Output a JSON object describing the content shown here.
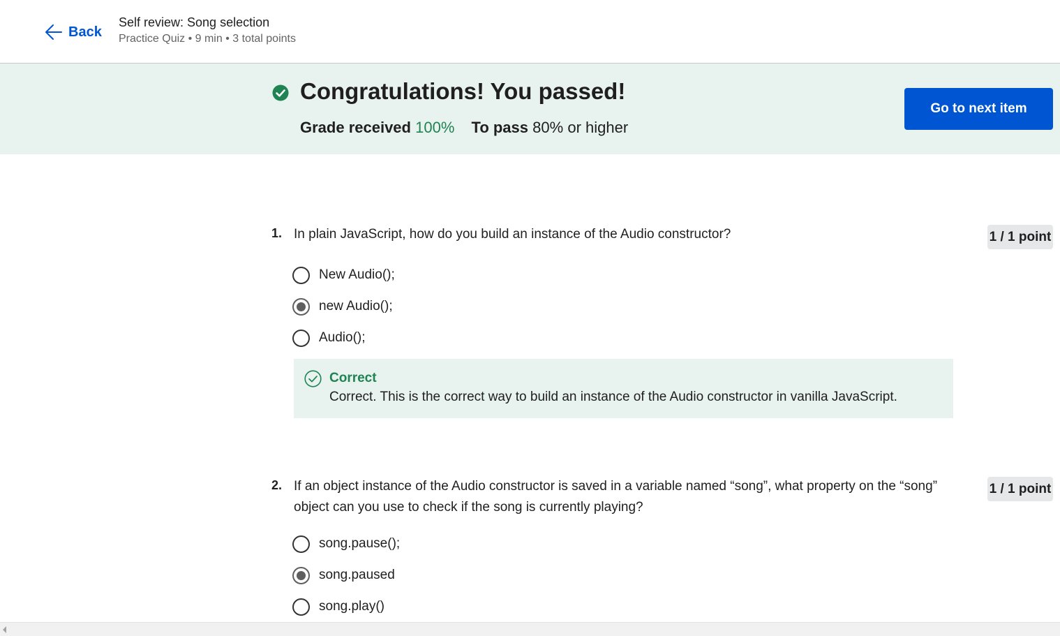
{
  "header": {
    "back_label": "Back",
    "title": "Self review: Song selection",
    "meta": "Practice Quiz • 9 min • 3 total points"
  },
  "banner": {
    "title": "Congratulations! You passed!",
    "grade_label": "Grade received",
    "grade_value": "100%",
    "pass_label": "To pass",
    "pass_value": "80%",
    "pass_suffix": "or higher",
    "next_button": "Go to next item"
  },
  "questions": [
    {
      "number": "1.",
      "text": "In plain JavaScript, how do you build an instance of the Audio constructor?",
      "points": "1 / 1 point",
      "options": [
        {
          "label": "New Audio();",
          "selected": false
        },
        {
          "label": "new Audio();",
          "selected": true
        },
        {
          "label": "Audio();",
          "selected": false
        }
      ],
      "feedback": {
        "title": "Correct",
        "text": "Correct. This is the correct way to build an instance of the Audio constructor in vanilla JavaScript."
      }
    },
    {
      "number": "2.",
      "text": "If an object instance of the Audio constructor is saved in a variable named “song”, what property on the “song” object can you use to check if the song is currently playing?",
      "points": "1 / 1 point",
      "options": [
        {
          "label": "song.pause();",
          "selected": false
        },
        {
          "label": "song.paused",
          "selected": true
        },
        {
          "label": "song.play()",
          "selected": false
        }
      ]
    }
  ],
  "colors": {
    "accent": "#0056d2",
    "success": "#1f8354",
    "banner_bg": "#e8f2ee"
  },
  "icons": {
    "back": "arrow-left-icon",
    "banner": "check-circle-filled-icon",
    "feedback": "check-circle-outline-icon"
  }
}
